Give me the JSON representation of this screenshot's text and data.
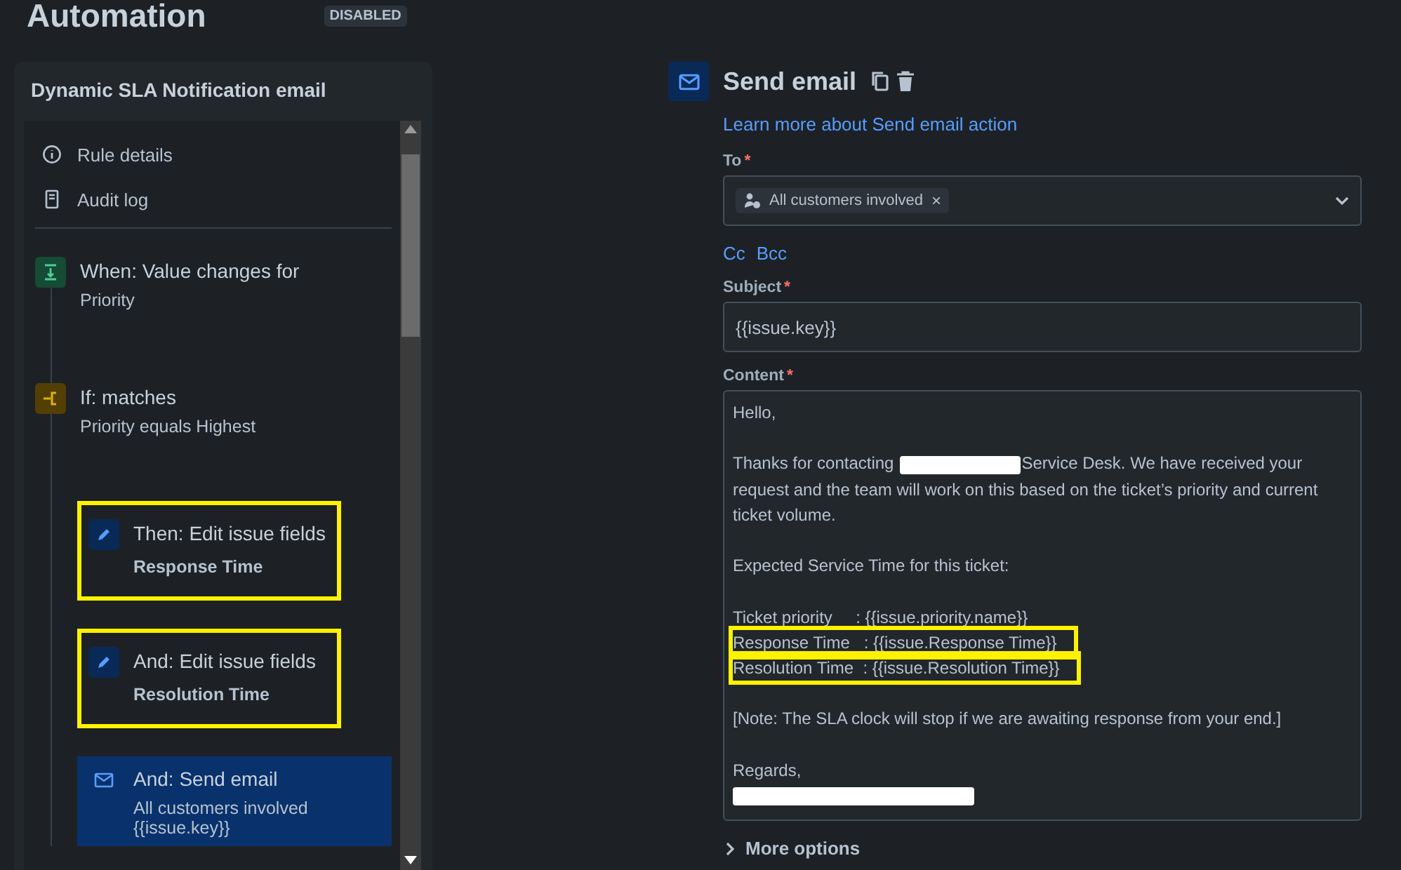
{
  "page": {
    "title": "Automation",
    "status": "DISABLED"
  },
  "rule": {
    "name": "Dynamic SLA Notification email",
    "nav": [
      {
        "kind": "info",
        "label": "Rule details"
      },
      {
        "kind": "log",
        "label": "Audit log"
      }
    ],
    "steps": [
      {
        "kind": "trigger",
        "title": "When: Value changes for",
        "details": [
          "Priority"
        ],
        "highlighted": false,
        "selected": false
      },
      {
        "kind": "condition",
        "title": "If: matches",
        "details": [
          "Priority equals Highest"
        ],
        "highlighted": false,
        "selected": false
      },
      {
        "kind": "edit",
        "title": "Then: Edit issue fields",
        "details": [
          "Response Time"
        ],
        "highlighted": true,
        "selected": false
      },
      {
        "kind": "edit",
        "title": "And: Edit issue fields",
        "details": [
          "Resolution Time"
        ],
        "highlighted": true,
        "selected": false
      },
      {
        "kind": "email",
        "title": "And: Send email",
        "details": [
          "All customers involved",
          "{{issue.key}}"
        ],
        "highlighted": false,
        "selected": true
      }
    ]
  },
  "action": {
    "title": "Send email",
    "learn_more": "Learn more about Send email action",
    "to": {
      "label": "To",
      "required_mark": "*",
      "chips": [
        {
          "label": "All customers involved",
          "remove": "×"
        }
      ]
    },
    "cc": "Cc",
    "bcc": "Bcc",
    "subject": {
      "label": "Subject",
      "required_mark": "*",
      "value": "{{issue.key}}"
    },
    "content": {
      "label": "Content",
      "required_mark": "*",
      "lines": [
        {
          "kind": "text",
          "parts": [
            "Hello,"
          ],
          "highlighted": false
        },
        {
          "kind": "blank",
          "highlighted": false
        },
        {
          "kind": "text",
          "parts": [
            "Thanks for contacting",
            "Service Desk. We have received your request and the team will work on this based on the ticket’s priority and current ticket volume."
          ],
          "highlighted": false
        },
        {
          "kind": "blank",
          "highlighted": false
        },
        {
          "kind": "text",
          "parts": [
            "Expected Service Time for this ticket:"
          ],
          "highlighted": false
        },
        {
          "kind": "blank",
          "highlighted": false
        },
        {
          "kind": "text",
          "parts": [
            "Ticket priority     : {{issue.priority.name}}"
          ],
          "highlighted": false
        },
        {
          "kind": "text",
          "parts": [
            "Response Time   : {{issue.Response Time}}"
          ],
          "highlighted": true
        },
        {
          "kind": "text",
          "parts": [
            "Resolution Time  : {{issue.Resolution Time}}"
          ],
          "highlighted": true
        },
        {
          "kind": "blank",
          "highlighted": false
        },
        {
          "kind": "text",
          "parts": [
            "[Note: The SLA clock will stop if we are awaiting response from your end.]"
          ],
          "highlighted": false
        },
        {
          "kind": "blank",
          "highlighted": false
        },
        {
          "kind": "text",
          "parts": [
            "Regards,"
          ],
          "highlighted": false
        },
        {
          "kind": "redacted",
          "highlighted": false
        }
      ]
    },
    "more_options": "More options"
  }
}
